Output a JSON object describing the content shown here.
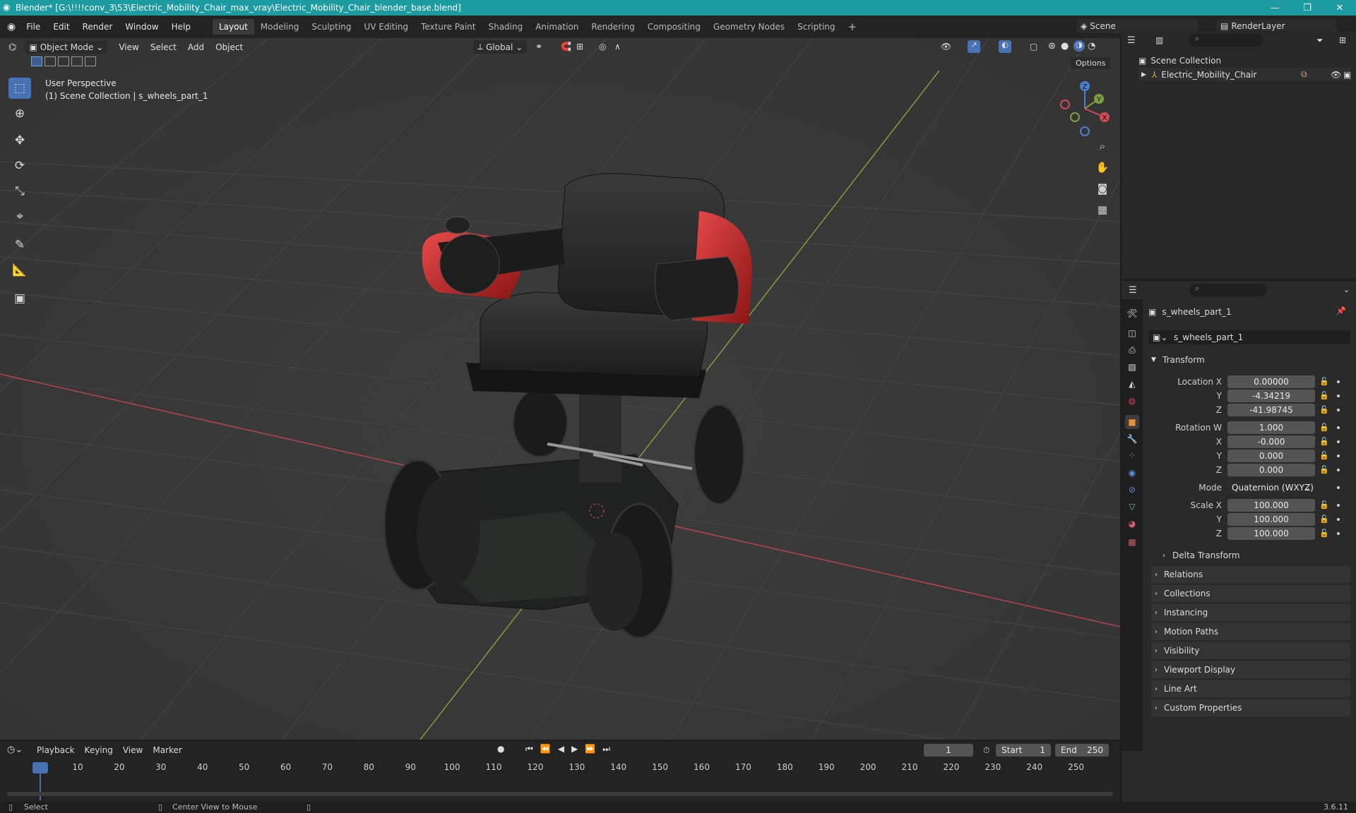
{
  "window": {
    "title": "Blender* [G:\\!!!!conv_3\\53\\Electric_Mobility_Chair_max_vray\\Electric_Mobility_Chair_blender_base.blend]",
    "minimize": "—",
    "maximize": "❐",
    "close": "✕"
  },
  "menu": [
    "File",
    "Edit",
    "Render",
    "Window",
    "Help"
  ],
  "workspaces": [
    "Layout",
    "Modeling",
    "Sculpting",
    "UV Editing",
    "Texture Paint",
    "Shading",
    "Animation",
    "Rendering",
    "Compositing",
    "Geometry Nodes",
    "Scripting"
  ],
  "workspace_add": "+",
  "scene": {
    "name": "Scene",
    "render_layer": "RenderLayer"
  },
  "viewport": {
    "mode": "Object Mode",
    "menus": [
      "View",
      "Select",
      "Add",
      "Object"
    ],
    "orientation": "Global",
    "options_label": "Options",
    "overlay_line1": "User Perspective",
    "overlay_line2": "(1) Scene Collection | s_wheels_part_1",
    "gizmo_x": "X",
    "gizmo_y": "Y",
    "gizmo_z": "Z",
    "colors": {
      "bg": "#3a3a3a",
      "grid": "#464646",
      "x_axis": "#b8454c",
      "y_axis": "#7ca040",
      "active_tool": "#4772b3"
    }
  },
  "outliner": {
    "search_placeholder": "",
    "root": "Scene Collection",
    "items": [
      {
        "label": "Electric_Mobility_Chair"
      }
    ]
  },
  "properties": {
    "object_name": "s_wheels_part_1",
    "data_name": "s_wheels_part_1",
    "transform_header": "Transform",
    "location": {
      "label_x": "Location X",
      "label_y": "Y",
      "label_z": "Z",
      "x": "0.00000",
      "y": "-4.34219",
      "z": "-41.98745"
    },
    "rotation": {
      "label_w": "Rotation W",
      "label_x": "X",
      "label_y": "Y",
      "label_z": "Z",
      "w": "1.000",
      "x": "-0.000",
      "y": "0.000",
      "z": "0.000"
    },
    "mode_label": "Mode",
    "mode_value": "Quaternion (WXYZ)",
    "scale": {
      "label_x": "Scale X",
      "label_y": "Y",
      "label_z": "Z",
      "x": "100.000",
      "y": "100.000",
      "z": "100.000"
    },
    "delta": "Delta Transform",
    "sections": [
      "Relations",
      "Collections",
      "Instancing",
      "Motion Paths",
      "Visibility",
      "Viewport Display",
      "Line Art",
      "Custom Properties"
    ]
  },
  "timeline": {
    "menus": [
      "Playback",
      "Keying",
      "View",
      "Marker"
    ],
    "current_frame": "1",
    "start_label": "Start",
    "start": "1",
    "end_label": "End",
    "end": "250",
    "ticks": [
      "1",
      "10",
      "20",
      "30",
      "40",
      "50",
      "60",
      "70",
      "80",
      "90",
      "100",
      "110",
      "120",
      "130",
      "140",
      "150",
      "160",
      "170",
      "180",
      "190",
      "200",
      "210",
      "220",
      "230",
      "240",
      "250"
    ]
  },
  "status": {
    "left": "Select",
    "middle": "Center View to Mouse",
    "version": "3.6.11"
  }
}
